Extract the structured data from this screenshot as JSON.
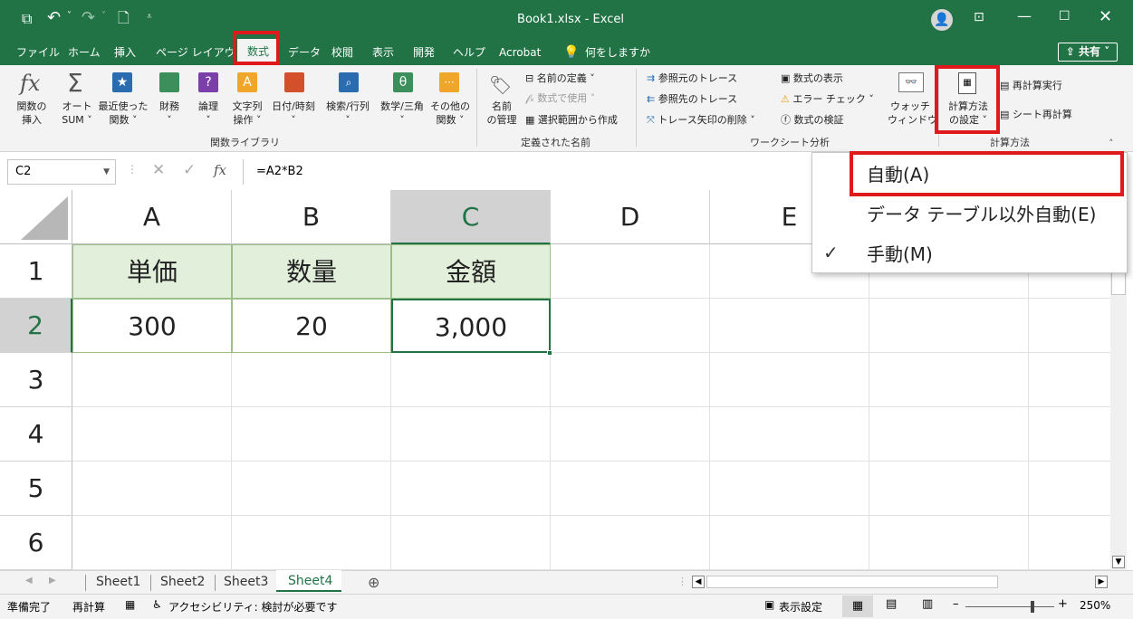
{
  "window": {
    "title": "Book1.xlsx  -  Excel",
    "share_label": "共有"
  },
  "menu": {
    "tabs": [
      "ファイル",
      "ホーム",
      "挿入",
      "ページ レイアウト",
      "数式",
      "データ",
      "校閲",
      "表示",
      "開発",
      "ヘルプ",
      "Acrobat"
    ],
    "search": "何をしますか"
  },
  "ribbon": {
    "function_library": {
      "insert_function": "関数の\n挿入",
      "autosum": "オート\nSUM ˅",
      "recent": "最近使った\n関数 ˅",
      "financial": "財務\n˅",
      "logical": "論理\n˅",
      "text": "文字列\n操作 ˅",
      "datetime": "日付/時刻\n˅",
      "lookup": "検索/行列\n˅",
      "math": "数学/三角\n˅",
      "more": "その他の\n関数 ˅",
      "group_label": "関数ライブラリ"
    },
    "defined_names": {
      "name_manager": "名前\nの管理",
      "define_name": "名前の定義  ˅",
      "use_in_formula": "数式で使用 ˅",
      "create_from_selection": "選択範囲から作成",
      "group_label": "定義された名前"
    },
    "formula_auditing": {
      "trace_precedents": "参照元のトレース",
      "trace_dependents": "参照先のトレース",
      "remove_arrows": "トレース矢印の削除  ˅",
      "show_formulas": "数式の表示",
      "error_checking": "エラー チェック  ˅",
      "evaluate_formula": "数式の検証",
      "watch_window": "ウォッチ\nウィンドウ",
      "group_label": "ワークシート分析"
    },
    "calculation": {
      "options": "計算方法\nの設定 ˅",
      "calc_now": "再計算実行",
      "calc_sheet": "シート再計算",
      "group_label": "計算方法"
    }
  },
  "formula_bar": {
    "name_box": "C2",
    "formula": "=A2*B2"
  },
  "columns": [
    "A",
    "B",
    "C",
    "D",
    "E"
  ],
  "rows": [
    "1",
    "2",
    "3",
    "4",
    "5",
    "6"
  ],
  "cells": {
    "A1": "単価",
    "B1": "数量",
    "C1": "金額",
    "A2": "300",
    "B2": "20",
    "C2": "3,000"
  },
  "dropdown": {
    "items": [
      {
        "label": "自動(A)",
        "checked": false
      },
      {
        "label": "データ テーブル以外自動(E)",
        "checked": false
      },
      {
        "label": "手動(M)",
        "checked": true
      }
    ],
    "check_glyph": "✓"
  },
  "sheets": [
    "Sheet1",
    "Sheet2",
    "Sheet3",
    "Sheet4"
  ],
  "active_sheet": "Sheet4",
  "status": {
    "ready": "準備完了",
    "recalc": "再計算",
    "accessibility": "アクセシビリティ: 検討が必要です",
    "display_settings": "表示設定",
    "zoom": "250%"
  },
  "colors": {
    "excel_green": "#217346",
    "header_fill": "#e2efda",
    "highlight_red": "#e0191c"
  }
}
